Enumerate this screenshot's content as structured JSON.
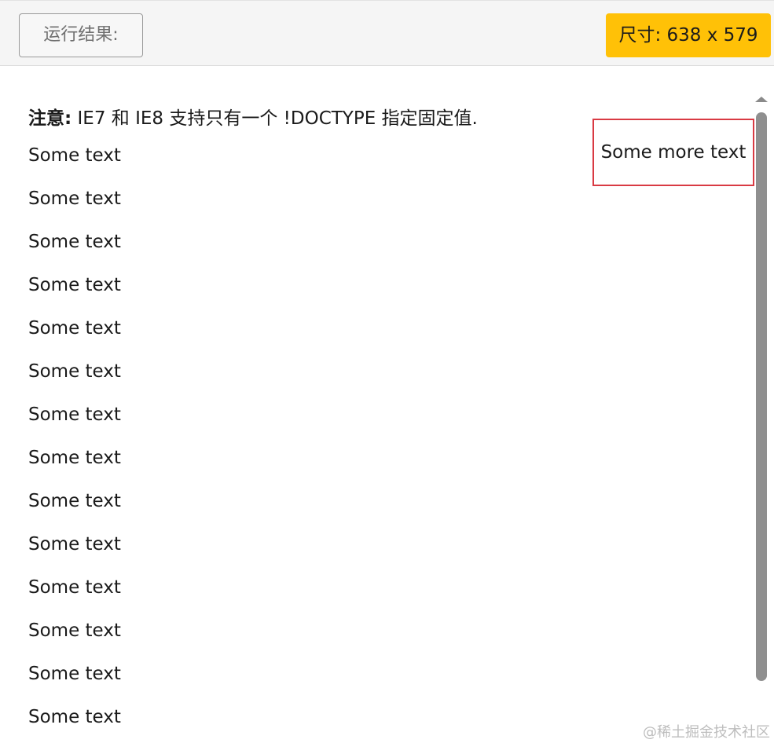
{
  "toolbar": {
    "run_label": "运行结果:",
    "size_label": "尺寸: 638 x 579"
  },
  "result": {
    "note_bold": "注意:",
    "note_text": " IE7 和 IE8 支持只有一个 !DOCTYPE 指定固定值.",
    "lines": [
      "Some text",
      "Some text",
      "Some text",
      "Some text",
      "Some text",
      "Some text",
      "Some text",
      "Some text",
      "Some text",
      "Some text",
      "Some text",
      "Some text",
      "Some text",
      "Some text"
    ],
    "float_box": "Some more text"
  },
  "watermark": "@稀土掘金技术社区",
  "colors": {
    "badge": "#ffc107",
    "box_border": "#d93a43",
    "scrollbar": "#8f8f8f"
  }
}
